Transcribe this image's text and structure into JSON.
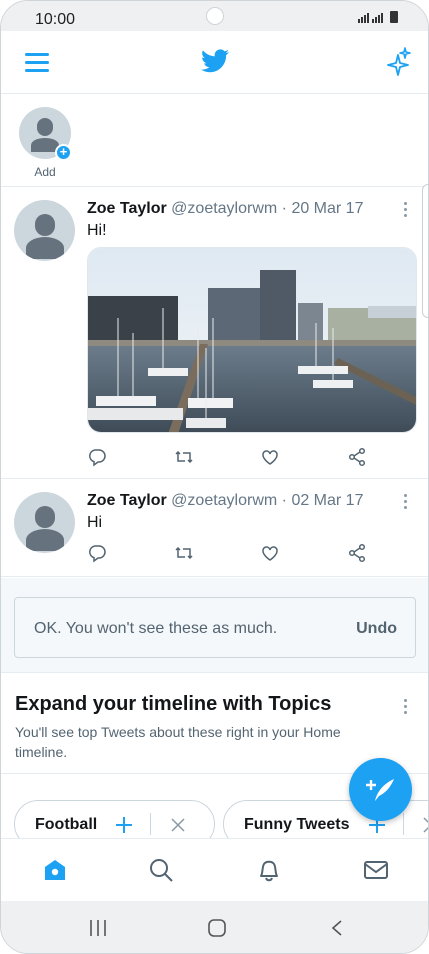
{
  "status_bar": {
    "time": "10:00"
  },
  "fleets": {
    "add_label": "Add"
  },
  "tweets": [
    {
      "name": "Zoe Taylor",
      "handle": "@zoetaylorwm",
      "date": "20 Mar 17",
      "separator": " · ",
      "text": "Hi!",
      "has_photo": true
    },
    {
      "name": "Zoe Taylor",
      "handle": "@zoetaylorwm",
      "date": "02 Mar 17",
      "separator": " · ",
      "text": "Hi",
      "has_photo": false
    }
  ],
  "notice": {
    "message": "OK. You won't see these as much.",
    "undo_label": "Undo"
  },
  "topics": {
    "title": "Expand your timeline with Topics",
    "subtitle": "You'll see top Tweets about these right in your Home timeline.",
    "chips": [
      {
        "label": "Football"
      },
      {
        "label": "Funny Tweets"
      }
    ]
  },
  "colors": {
    "accent": "#1da1f2",
    "text": "#14171a",
    "secondary": "#657786"
  },
  "icons": {
    "header": [
      "menu-icon",
      "twitter-logo-icon",
      "sparkle-icon"
    ],
    "tweet_actions": [
      "reply-icon",
      "retweet-icon",
      "like-icon",
      "share-icon"
    ],
    "tabs": [
      "home-icon",
      "search-icon",
      "notifications-icon",
      "messages-icon"
    ],
    "fab": "compose-tweet-icon",
    "system_nav": [
      "recents-icon",
      "home-button-icon",
      "back-icon"
    ]
  }
}
